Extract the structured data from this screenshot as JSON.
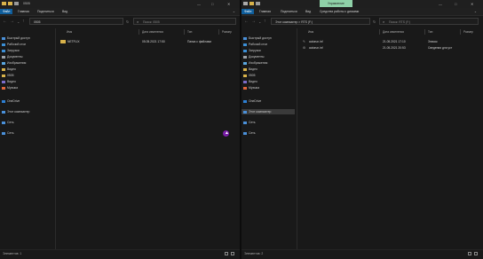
{
  "left": {
    "title": "0505",
    "tabs": [
      "Файл",
      "Главная",
      "Поделиться",
      "Вид"
    ],
    "path": "0505",
    "search_placeholder": "Поиск: 0505",
    "nav": [
      {
        "label": "Быстрый доступ",
        "icon": "star-icon",
        "color": "#4a90d9"
      },
      {
        "label": "Рабочий стол",
        "icon": "desktop-icon",
        "color": "#3b8fd6"
      },
      {
        "label": "Загрузки",
        "icon": "downloads-icon",
        "color": "#3b8fd6"
      },
      {
        "label": "Документы",
        "icon": "documents-icon",
        "color": "#9aa0a6"
      },
      {
        "label": "Изображения",
        "icon": "pictures-icon",
        "color": "#5aa7e0"
      },
      {
        "label": "Видео",
        "icon": "folder-icon",
        "color": "#d8b24a"
      },
      {
        "label": "0505",
        "icon": "folder-icon",
        "color": "#d8b24a"
      },
      {
        "label": "Видео",
        "icon": "videos-icon",
        "color": "#7a6cc9"
      },
      {
        "label": "Музыка",
        "icon": "music-icon",
        "color": "#e0663b"
      },
      {
        "label": "OneDrive",
        "icon": "onedrive-icon",
        "color": "#2d7fd3"
      },
      {
        "label": "Этот компьютер",
        "icon": "computer-icon",
        "color": "#4a90d9"
      },
      {
        "label": "Сеть",
        "icon": "network-icon",
        "color": "#4a90d9"
      },
      {
        "label": "Сеть",
        "icon": "network-icon",
        "color": "#4a90d9"
      }
    ],
    "columns": [
      "Имя",
      "Дата изменения",
      "Тип",
      "Размер"
    ],
    "files": [
      {
        "name": "NETFLIX",
        "date": "05.05.2021 17:50",
        "type": "Папка с файлами",
        "size": ""
      }
    ],
    "status": "Элементов: 1"
  },
  "right": {
    "title": "Управление",
    "tabs": [
      "Файл",
      "Главная",
      "Поделиться",
      "Вид"
    ],
    "manage_tab": "Управление",
    "tools_tab": "Средства работы с дисками",
    "path": "Этот компьютер > RTS (F:)",
    "search_placeholder": "Поиск: RTS (F:)",
    "nav": [
      {
        "label": "Быстрый доступ",
        "icon": "star-icon",
        "color": "#4a90d9"
      },
      {
        "label": "Рабочий стол",
        "icon": "desktop-icon",
        "color": "#3b8fd6"
      },
      {
        "label": "Загрузки",
        "icon": "downloads-icon",
        "color": "#3b8fd6"
      },
      {
        "label": "Документы",
        "icon": "documents-icon",
        "color": "#9aa0a6"
      },
      {
        "label": "Изображения",
        "icon": "pictures-icon",
        "color": "#5aa7e0"
      },
      {
        "label": "Видео",
        "icon": "folder-icon",
        "color": "#d8b24a"
      },
      {
        "label": "0505",
        "icon": "folder-icon",
        "color": "#d8b24a"
      },
      {
        "label": "Видео",
        "icon": "videos-icon",
        "color": "#7a6cc9"
      },
      {
        "label": "Музыка",
        "icon": "music-icon",
        "color": "#e0663b"
      },
      {
        "label": "OneDrive",
        "icon": "onedrive-icon",
        "color": "#2d7fd3"
      },
      {
        "label": "Этот компьютер",
        "icon": "computer-icon",
        "color": "#4a90d9"
      },
      {
        "label": "Сеть",
        "icon": "network-icon",
        "color": "#4a90d9"
      },
      {
        "label": "Сеть",
        "icon": "network-icon",
        "color": "#4a90d9"
      }
    ],
    "columns": [
      "Имя",
      "Дата изменения",
      "Тип",
      "Размер"
    ],
    "files": [
      {
        "name": "autorun.inf",
        "date": "21.05.2021 17:10",
        "type": "Значок",
        "size": ""
      },
      {
        "name": "autorun.inf",
        "date": "21.05.2021 20:53",
        "type": "Сведения для уст",
        "size": ""
      }
    ],
    "status": "Элементов: 2"
  }
}
